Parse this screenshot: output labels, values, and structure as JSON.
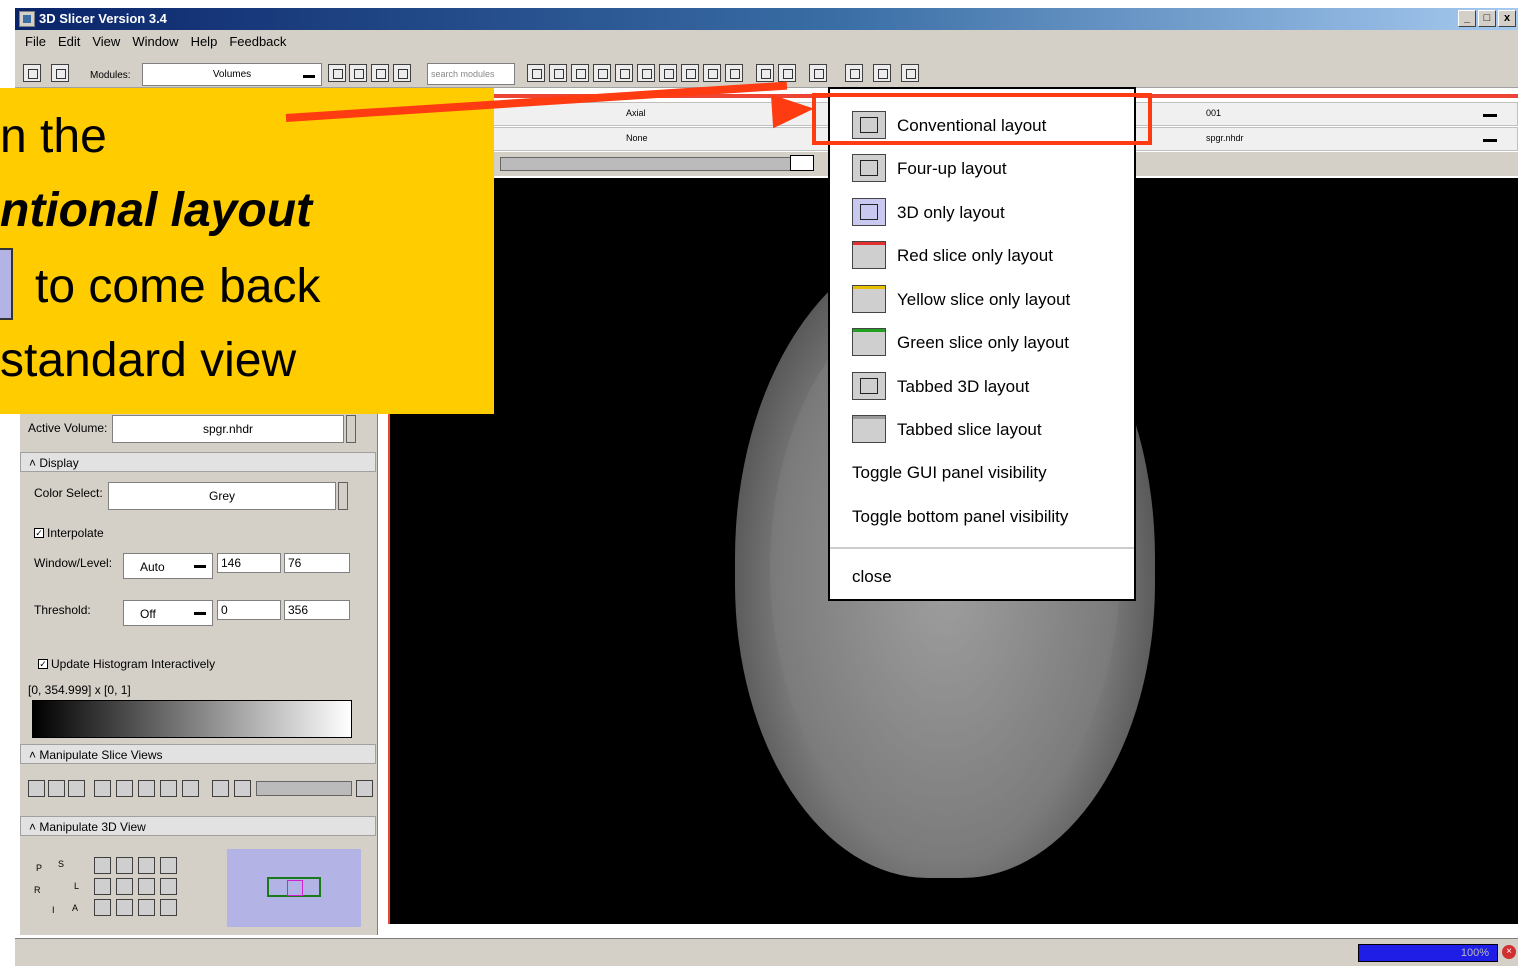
{
  "window": {
    "title": "3D Slicer Version 3.4",
    "controls": [
      "_",
      "□",
      "x"
    ]
  },
  "menubar": {
    "items": [
      "File",
      "Edit",
      "View",
      "Window",
      "Help",
      "Feedback"
    ]
  },
  "toolbar": {
    "modules_label": "Modules:",
    "module_selected": "Volumes",
    "search_placeholder": "search modules"
  },
  "slice_controls": {
    "row1": {
      "orientation": "Axial",
      "value": "001"
    },
    "row2": {
      "foreground": "None",
      "background": "spgr.nhdr"
    }
  },
  "callout": {
    "line1": "n the",
    "line2": "ntional layout",
    "line3": "to come back",
    "line4": "standard view"
  },
  "layout_menu": {
    "items": [
      {
        "label": "Conventional layout",
        "icon": "conventional-layout-icon"
      },
      {
        "label": "Four-up layout",
        "icon": "four-up-layout-icon"
      },
      {
        "label": "3D only layout",
        "icon": "3d-only-layout-icon"
      },
      {
        "label": "Red slice only layout",
        "icon": "red-slice-layout-icon",
        "color": "#e03030"
      },
      {
        "label": "Yellow slice only layout",
        "icon": "yellow-slice-layout-icon",
        "color": "#e6c000"
      },
      {
        "label": "Green slice only layout",
        "icon": "green-slice-layout-icon",
        "color": "#20a020"
      },
      {
        "label": "Tabbed 3D layout",
        "icon": "tabbed-3d-layout-icon"
      },
      {
        "label": "Tabbed slice layout",
        "icon": "tabbed-slice-layout-icon"
      },
      {
        "label": "Toggle GUI panel visibility"
      },
      {
        "label": "Toggle bottom panel visibility"
      },
      {
        "label": "close"
      }
    ]
  },
  "volumes_panel": {
    "active_volume_label": "Active Volume:",
    "active_volume": "spgr.nhdr",
    "display_section": "Display",
    "color_select_label": "Color Select:",
    "color_select": "Grey",
    "interpolate_label": "Interpolate",
    "window_level_label": "Window/Level:",
    "window_level_mode": "Auto",
    "window": "146",
    "level": "76",
    "threshold_label": "Threshold:",
    "threshold_mode": "Off",
    "threshold_min": "0",
    "threshold_max": "356",
    "update_histogram_label": "Update Histogram Interactively",
    "histogram_range": "[0, 354.999] x [0, 1]"
  },
  "manipulate_slice_views": {
    "title": "Manipulate Slice Views"
  },
  "manipulate_3d_view": {
    "title": "Manipulate 3D View",
    "axes": [
      "P",
      "S",
      "L",
      "R",
      "I",
      "A"
    ]
  },
  "status": {
    "progress": "100%"
  },
  "colors": {
    "accent": "#ff3b12",
    "callout": "#ffcc00",
    "slice_red": "#ee4433"
  }
}
